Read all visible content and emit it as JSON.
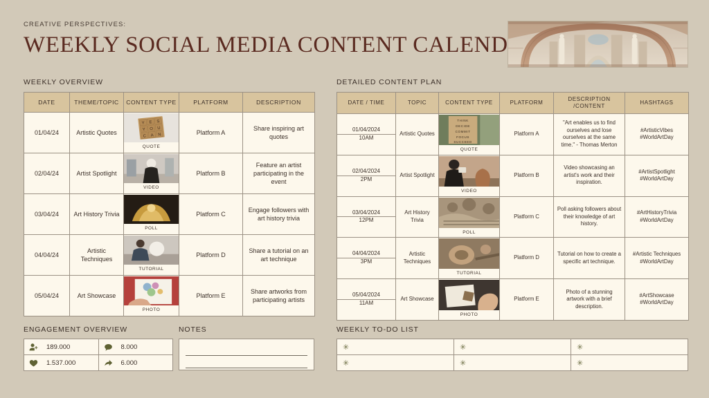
{
  "header": {
    "kicker": "CREATIVE PERSPECTIVES:",
    "title": "WEEKLY SOCIAL MEDIA CONTENT CALENDAR",
    "title_star": "✳",
    "photo_alt": "renaissance-fresco-arches"
  },
  "sections": {
    "weekly_overview": "WEEKLY OVERVIEW",
    "detailed_plan": "DETAILED CONTENT PLAN",
    "engagement": "ENGAGEMENT OVERVIEW",
    "notes": "NOTES",
    "todo": "WEEKLY TO-DO LIST"
  },
  "weekly_overview": {
    "columns": [
      "DATE",
      "THEME/TOPIC",
      "CONTENT TYPE",
      "PLATFORM",
      "DESCRIPTION"
    ],
    "rows": [
      {
        "date": "01/04/24",
        "theme": "Artistic Quotes",
        "content_type": "QUOTE",
        "thumb": "scrabble-yes-you-can",
        "platform": "Platform A",
        "description": "Share inspiring art quotes"
      },
      {
        "date": "02/04/24",
        "theme": "Artist Spotlight",
        "content_type": "VIDEO",
        "thumb": "artist-in-studio",
        "platform": "Platform B",
        "description": "Feature an artist participating in the event"
      },
      {
        "date": "03/04/24",
        "theme": "Art History Trivia",
        "content_type": "POLL",
        "thumb": "golden-sculpture",
        "platform": "Platform C",
        "description": "Engage followers with art history trivia"
      },
      {
        "date": "04/04/24",
        "theme": "Artistic Techniques",
        "content_type": "TUTORIAL",
        "thumb": "sculptor-at-work",
        "platform": "Platform D",
        "description": "Share a tutorial on an art technique"
      },
      {
        "date": "05/04/24",
        "theme": "Art Showcase",
        "content_type": "PHOTO",
        "thumb": "painting-watercolor",
        "platform": "Platform E",
        "description": "Share artworks from participating artists"
      }
    ]
  },
  "detailed_plan": {
    "columns": [
      "DATE / TIME",
      "TOPIC",
      "CONTENT TYPE",
      "PLATFORM",
      "DESCRIPTION /CONTENT",
      "HASHTAGS"
    ],
    "columns_desc_line1": "DESCRIPTION",
    "columns_desc_line2": "/CONTENT",
    "rows": [
      {
        "date": "01/04/2024",
        "time": "10AM",
        "topic": "Artistic Quotes",
        "content_type": "QUOTE",
        "thumb": "think-decide-commit-sign",
        "platform": "Platform A",
        "description": "\"Art enables us to find ourselves and lose ourselves at the same time.\" - Thomas Merton",
        "hashtags": "#ArtisticVibes #WorldArtDay"
      },
      {
        "date": "02/04/2024",
        "time": "2PM",
        "topic": "Artist Spotlight",
        "content_type": "VIDEO",
        "thumb": "photographer-pottery",
        "platform": "Platform B",
        "description": "Video showcasing an artist's work and their inspiration.",
        "hashtags": "#ArtistSpotlight #WorldArtDay"
      },
      {
        "date": "03/04/2024",
        "time": "12PM",
        "topic": "Art History Trivia",
        "content_type": "POLL",
        "thumb": "ancient-stone-relief",
        "platform": "Platform C",
        "description": "Poll asking followers about their knowledge of art history.",
        "hashtags": "#ArtHistoryTrivia #WorldArtDay"
      },
      {
        "date": "04/04/2024",
        "time": "3PM",
        "topic": "Artistic Techniques",
        "content_type": "TUTORIAL",
        "thumb": "clay-pottery-tools",
        "platform": "Platform D",
        "description": "Tutorial on how to create a specific art technique.",
        "hashtags": "#Artistic Techniques #WorldArtDay"
      },
      {
        "date": "05/04/2024",
        "time": "11AM",
        "topic": "Art Showcase",
        "content_type": "PHOTO",
        "thumb": "hand-holding-artifact",
        "platform": "Platform E",
        "description": "Photo of a stunning artwork with a brief description.",
        "hashtags": "#ArtShowcase #WorldArtDay"
      }
    ]
  },
  "engagement": {
    "metrics": [
      {
        "icon": "person-add-icon",
        "value": "189.000"
      },
      {
        "icon": "comment-icon",
        "value": "8.000"
      },
      {
        "icon": "heart-icon",
        "value": "1.537.000"
      },
      {
        "icon": "share-icon",
        "value": "6.000"
      }
    ]
  },
  "notes": {
    "lines": [
      "",
      ""
    ]
  },
  "todo": {
    "bullet": "✳",
    "items": [
      "",
      "",
      "",
      "",
      "",
      ""
    ]
  },
  "colors": {
    "background": "#d2c9b8",
    "table_header": "#d8c49e",
    "cell": "#fdf8ec",
    "border": "#9b9184",
    "title": "#5a2a20",
    "accent_green": "#6e7046",
    "text": "#3b2f28"
  }
}
